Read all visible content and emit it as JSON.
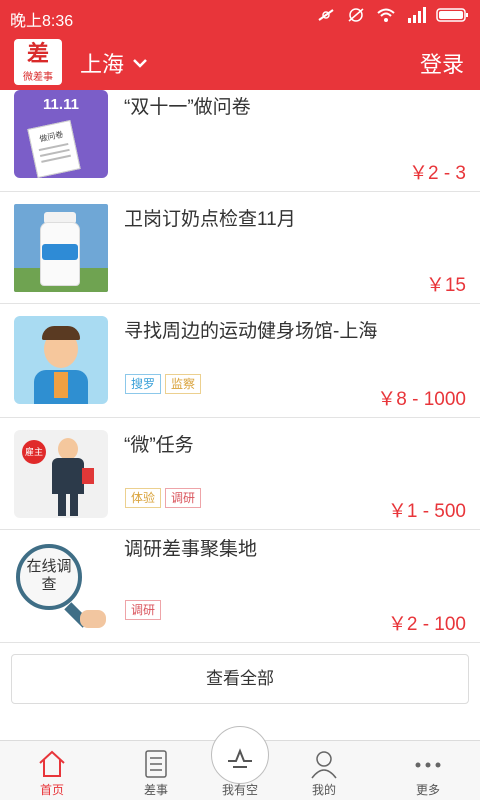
{
  "status_bar": {
    "time": "晚上8:36"
  },
  "header": {
    "logo_mark": "差",
    "logo_text": "微差事",
    "city": "上海",
    "login": "登录"
  },
  "tasks": [
    {
      "title": "“双十一”做问卷",
      "price": "￥2 - 3",
      "thumb_text": "11.11",
      "thumb_sub": "做问卷",
      "tags": []
    },
    {
      "title": "卫岗订奶点检查11月",
      "price": "￥15",
      "tags": []
    },
    {
      "title": "寻找周边的运动健身场馆-上海",
      "price": "￥8 - 1000",
      "tags": [
        "搜罗",
        "监察"
      ]
    },
    {
      "title": "“微”任务",
      "price": "￥1 - 500",
      "thumb_badge": "雇主",
      "tags": [
        "体验",
        "调研"
      ]
    },
    {
      "title": "调研差事聚集地",
      "price": "￥2 - 100",
      "thumb_text": "在线调查",
      "tags": [
        "调研"
      ]
    }
  ],
  "view_all": "查看全部",
  "tabbar": {
    "home": "首页",
    "errands": "差事",
    "free": "我有空",
    "mine": "我的",
    "more": "更多"
  },
  "colors": {
    "brand_red": "#e8353a",
    "tag_blue": "#3aa0d8",
    "tag_yellow": "#d9a23a",
    "tag_red": "#d9535b"
  },
  "icons": [
    "logo-icon",
    "chevron-down-icon",
    "home-icon",
    "list-icon",
    "free-time-icon",
    "user-icon",
    "more-icon"
  ]
}
